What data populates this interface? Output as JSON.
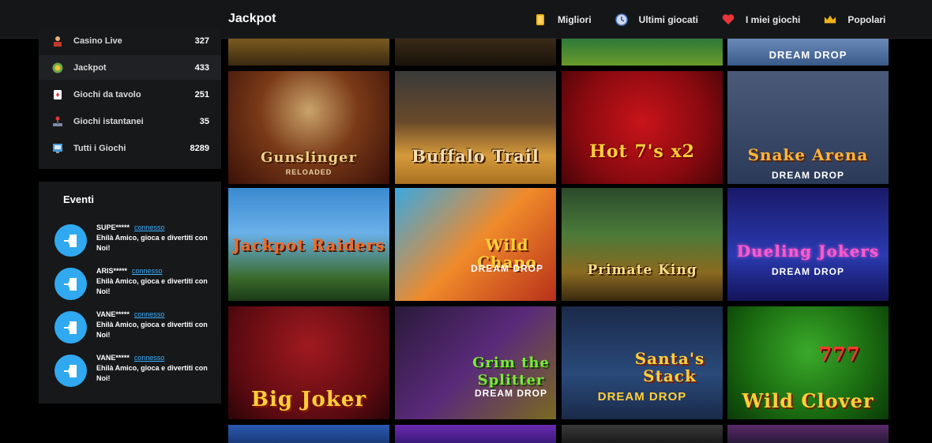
{
  "header": {
    "title": "Jackpot",
    "nav": [
      {
        "label": "Migliori",
        "icon": "gold-bar-icon"
      },
      {
        "label": "Ultimi giocati",
        "icon": "clock-icon"
      },
      {
        "label": "I miei giochi",
        "icon": "heart-icon"
      },
      {
        "label": "Popolari",
        "icon": "crown-icon"
      }
    ]
  },
  "sidebar": {
    "categories": [
      {
        "label": "Casino Live",
        "count": "327",
        "icon": "dealer-icon"
      },
      {
        "label": "Jackpot",
        "count": "433",
        "icon": "chip-icon"
      },
      {
        "label": "Giochi da tavolo",
        "count": "251",
        "icon": "card-icon"
      },
      {
        "label": "Giochi istantanei",
        "count": "35",
        "icon": "joystick-icon"
      },
      {
        "label": "Tutti i Giochi",
        "count": "8289",
        "icon": "slot-machine-icon"
      }
    ]
  },
  "events": {
    "title": "Eventi",
    "items": [
      {
        "user": "SUPE*****",
        "link": "connesso",
        "message": "Ehilà Amico, gioca e divertiti con Noi!"
      },
      {
        "user": "ARIS*****",
        "link": "connesso",
        "message": "Ehilà Amico, gioca e divertiti con Noi!"
      },
      {
        "user": "VANE*****",
        "link": "connesso",
        "message": "Ehilà Amico, gioca e divertiti con Noi!"
      },
      {
        "user": "VANE*****",
        "link": "connesso",
        "message": "Ehilà Amico, gioca e divertiti con Noi!"
      }
    ]
  },
  "games": {
    "row1": [
      {
        "name": "Gunslinger",
        "sub": "RELOADED"
      },
      {
        "name": "Buffalo Trail",
        "sub": ""
      },
      {
        "name": "Hot 7's x2",
        "sub": ""
      },
      {
        "name": "Snake Arena",
        "sub": "DREAM DROP"
      }
    ],
    "row2": [
      {
        "name": "Jackpot Raiders",
        "sub": ""
      },
      {
        "name": "Wild Chapo",
        "sub": "DREAM DROP"
      },
      {
        "name": "Primate King",
        "sub": ""
      },
      {
        "name": "Dueling Jokers",
        "sub": "DREAM DROP"
      }
    ],
    "row3": [
      {
        "name": "Big Joker",
        "sub": ""
      },
      {
        "name": "Grim the Splitter",
        "sub": "DREAM DROP"
      },
      {
        "name": "Santa's Stack",
        "sub": "DREAM DROP"
      },
      {
        "name": "Wild Clover",
        "sub": "777"
      }
    ],
    "row0_partial": [
      {
        "name": "",
        "sub": ""
      },
      {
        "name": "",
        "sub": ""
      },
      {
        "name": "",
        "sub": ""
      },
      {
        "name": "",
        "sub": "DREAM DROP"
      }
    ]
  }
}
